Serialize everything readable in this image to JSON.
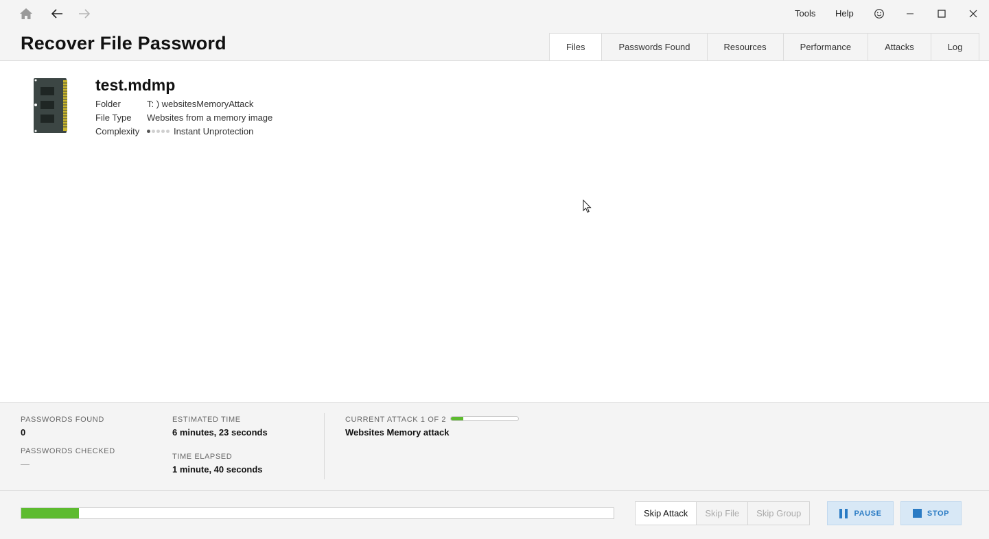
{
  "titlebar": {
    "menu": [
      "Tools",
      "Help"
    ]
  },
  "header": {
    "title": "Recover File Password",
    "tabs": [
      {
        "label": "Files",
        "active": true
      },
      {
        "label": "Passwords Found",
        "active": false
      },
      {
        "label": "Resources",
        "active": false
      },
      {
        "label": "Performance",
        "active": false
      },
      {
        "label": "Attacks",
        "active": false
      },
      {
        "label": "Log",
        "active": false
      }
    ]
  },
  "file": {
    "name": "test.mdmp",
    "folder_label": "Folder",
    "folder_value": "T: ) websitesMemoryAttack",
    "type_label": "File Type",
    "type_value": "Websites from a memory image",
    "complexity_label": "Complexity",
    "complexity_value": "Instant Unprotection",
    "complexity_level": 1,
    "complexity_max": 5,
    "icon": "memory-module-icon"
  },
  "stats": {
    "passwords_found_label": "PASSWORDS FOUND",
    "passwords_found_value": "0",
    "passwords_checked_label": "PASSWORDS CHECKED",
    "passwords_checked_value": "—",
    "estimated_time_label": "ESTIMATED TIME",
    "estimated_time_value": "6 minutes, 23 seconds",
    "time_elapsed_label": "TIME ELAPSED",
    "time_elapsed_value": "1 minute, 40 seconds",
    "current_attack_label": "CURRENT ATTACK 1 OF 2",
    "current_attack_value": "Websites Memory attack",
    "attack_progress": 0.18
  },
  "bottom": {
    "overall_progress": 0.097,
    "skip_attack": "Skip Attack",
    "skip_file": "Skip File",
    "skip_group": "Skip Group",
    "pause": "PAUSE",
    "stop": "STOP"
  },
  "colors": {
    "progress": "#5dbb2f",
    "accent": "#2a7bc4",
    "action_bg": "#d8e8f6"
  }
}
